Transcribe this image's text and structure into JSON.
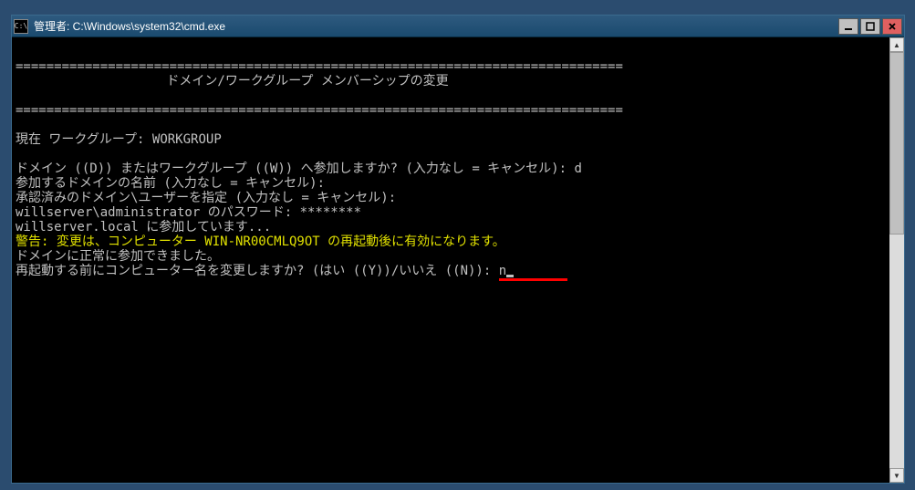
{
  "titlebar": {
    "icon_text": "C:\\",
    "title": "管理者: C:\\Windows\\system32\\cmd.exe"
  },
  "console": {
    "divider": "===============================================================================",
    "heading": "ドメイン/ワークグループ メンバーシップの変更",
    "current_workgroup": "現在 ワークグループ: WORKGROUP",
    "join_prompt": "ドメイン ((D)) またはワークグループ ((W)) へ参加しますか? (入力なし = キャンセル): d",
    "domain_name_prompt": "参加するドメインの名前 (入力なし = キャンセル):",
    "auth_user_prompt": "承認済みのドメイン\\ユーザーを指定 (入力なし = キャンセル):",
    "password_prompt": "willserver\\administrator のパスワード: ********",
    "joining": "willserver.local に参加しています...",
    "warning": "警告: 変更は、コンピューター WIN-NR00CMLQ9OT の再起動後に有効になります。",
    "success": "ドメインに正常に参加できました。",
    "rename_prompt": "再起動する前にコンピューター名を変更しますか? (はい ((Y))/いいえ ((N)): ",
    "rename_input": "n"
  }
}
